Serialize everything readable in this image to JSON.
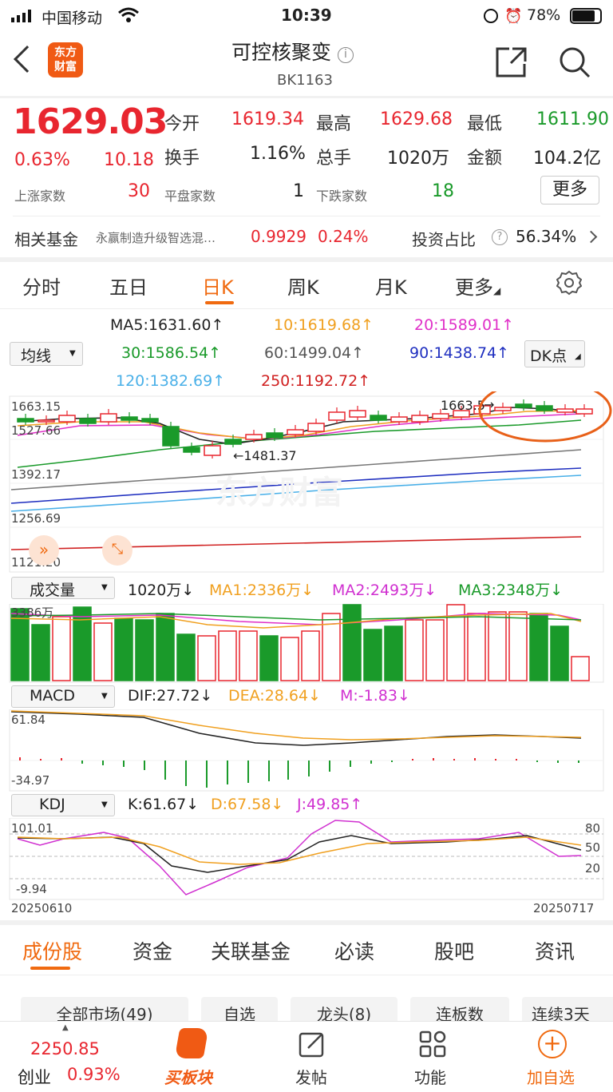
{
  "status": {
    "carrier": "中国移动",
    "time": "10:39",
    "battery": "78%"
  },
  "header": {
    "logo_line1": "东方",
    "logo_line2": "财富",
    "title": "可控核聚变",
    "code": "BK1163"
  },
  "quote": {
    "price": "1629.03",
    "pct": "0.63%",
    "chg": "10.18",
    "open_label": "今开",
    "open": "1619.34",
    "high_label": "最高",
    "high": "1629.68",
    "low_label": "最低",
    "low": "1611.90",
    "turnover_label": "换手",
    "turnover": "1.16%",
    "vol_label": "总手",
    "vol": "1020万",
    "amount_label": "金额",
    "amount": "104.2亿",
    "up_label": "上涨家数",
    "up": "30",
    "flat_label": "平盘家数",
    "flat": "1",
    "down_label": "下跌家数",
    "down": "18",
    "more": "更多"
  },
  "fund": {
    "label": "相关基金",
    "name": "永赢制造升级智选混…",
    "nav": "0.9929",
    "pct": "0.24%",
    "ratio_label": "投资占比",
    "ratio": "56.34%"
  },
  "tabs": [
    "分时",
    "五日",
    "日K",
    "周K",
    "月K",
    "更多"
  ],
  "ma": {
    "selector": "均线",
    "dk": "DK点",
    "ma5": "MA5:1631.60↑",
    "ma10": "10:1619.68↑",
    "ma20": "20:1589.01↑",
    "ma30": "30:1586.54↑",
    "ma60": "60:1499.04↑",
    "ma90": "90:1438.74↑",
    "ma120": "120:1382.69↑",
    "ma250": "250:1192.72↑"
  },
  "kline": {
    "y1": "1663.15",
    "y2": "1527.66",
    "y3": "1392.17",
    "y4": "1256.69",
    "y5": "1121.20",
    "hi_note": "1663.5",
    "lo_note": "←1481.37",
    "watermark": "东方财富"
  },
  "volume": {
    "selector": "成交量",
    "val": "1020万↓",
    "ma1": "MA1:2336万↓",
    "ma2": "MA2:2493万↓",
    "ma3": "MA3:2348万↓",
    "ymax": "3386万"
  },
  "macd": {
    "selector": "MACD",
    "dif": "DIF:27.72↓",
    "dea": "DEA:28.64↓",
    "m": "M:-1.83↓",
    "ymax": "61.84",
    "ymin": "-34.97"
  },
  "kdj": {
    "selector": "KDJ",
    "k": "K:61.67↓",
    "d": "D:67.58↓",
    "j": "J:49.85↑",
    "ymax": "101.01",
    "ymin": "-9.94",
    "l80": "80",
    "l50": "50",
    "l20": "20"
  },
  "dates": {
    "start": "20250610",
    "end": "20250717"
  },
  "bottom_tabs": [
    "成份股",
    "资金",
    "关联基金",
    "必读",
    "股吧",
    "资讯"
  ],
  "filters": [
    "全部市场(49)",
    "自选",
    "龙头(8)",
    "连板数",
    "连续3天"
  ],
  "nav": {
    "index_val": "2250.85",
    "index_name": "创业",
    "index_pct": "0.93%",
    "buy": "买板块",
    "post": "发帖",
    "func": "功能",
    "add": "加自选"
  },
  "colors": {
    "up": "#e8262f",
    "down": "#1a9a2a",
    "accent": "#f06a10"
  }
}
